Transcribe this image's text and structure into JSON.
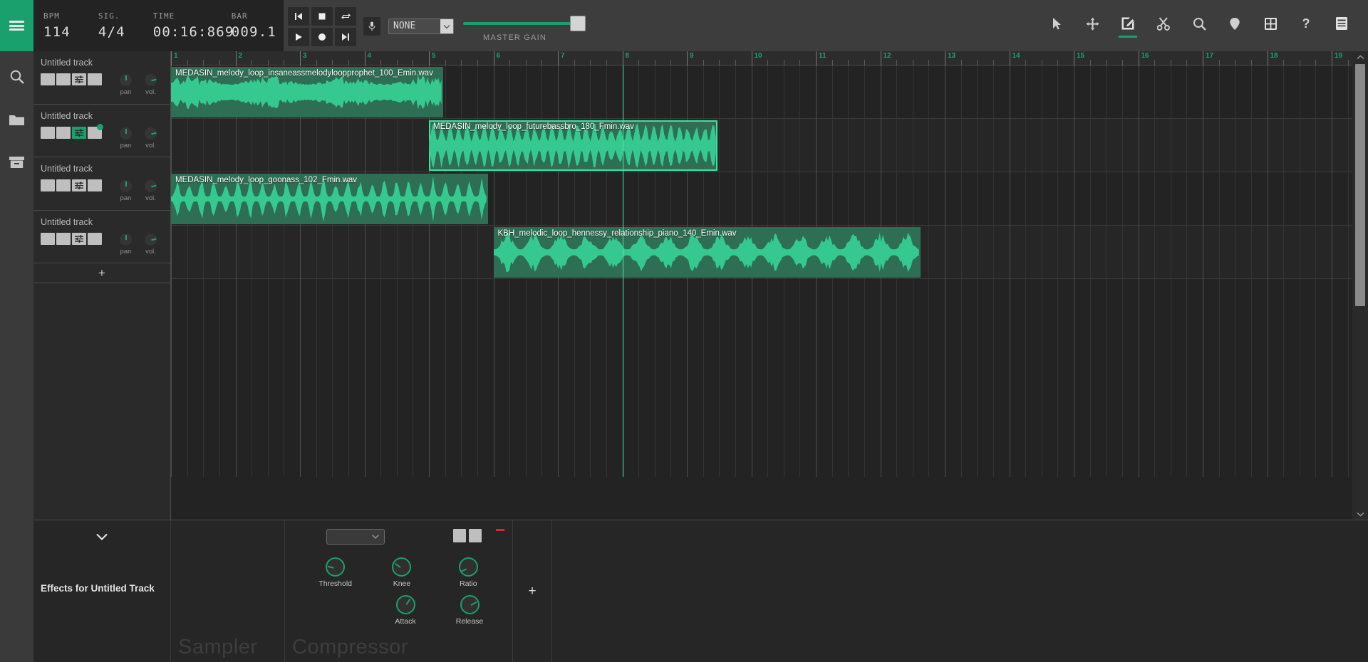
{
  "app": {
    "accent": "#1aa06d",
    "clip_color": "#2e6e55",
    "wave_color": "#35c98f",
    "selected_border": "#3ce0a0"
  },
  "topbar": {
    "menu_icon": "hamburger-icon",
    "lcd": [
      {
        "label": "BPM",
        "value": "114",
        "name": "bpm"
      },
      {
        "label": "SIG.",
        "value": "4/4",
        "name": "time-signature"
      },
      {
        "label": "TIME",
        "value": "00:16:869",
        "name": "time"
      },
      {
        "label": "BAR",
        "value": "009.1",
        "name": "bar"
      }
    ],
    "transport": [
      {
        "name": "skip-to-start-button",
        "icon": "skip-back-icon"
      },
      {
        "name": "stop-button",
        "icon": "stop-icon"
      },
      {
        "name": "loop-button",
        "icon": "loop-icon"
      },
      {
        "name": "play-button",
        "icon": "play-icon"
      },
      {
        "name": "record-button",
        "icon": "record-icon"
      },
      {
        "name": "skip-to-end-button",
        "icon": "skip-forward-icon"
      }
    ],
    "mic_icon": "microphone-icon",
    "input_select": {
      "value": "NONE",
      "options": [
        "NONE"
      ]
    },
    "master_gain": {
      "label": "MASTER GAIN",
      "value": 100
    },
    "tools": [
      {
        "name": "select-tool",
        "icon": "cursor-arrow-icon",
        "active": false
      },
      {
        "name": "move-tool",
        "icon": "move-arrows-icon",
        "active": false
      },
      {
        "name": "draw-tool",
        "icon": "pencil-edit-icon",
        "active": true
      },
      {
        "name": "cut-tool",
        "icon": "scissors-icon",
        "active": false
      },
      {
        "name": "zoom-tool",
        "icon": "magnifier-icon",
        "active": false
      },
      {
        "name": "marker-tool",
        "icon": "map-pin-icon",
        "active": false
      },
      {
        "name": "grid-tool",
        "icon": "grid-icon",
        "active": false
      },
      {
        "name": "help-button",
        "icon": "question-mark-icon",
        "active": false
      },
      {
        "name": "list-panel-button",
        "icon": "list-icon",
        "active": false
      }
    ]
  },
  "rail": [
    {
      "name": "sidebar-item-search",
      "icon": "search-icon"
    },
    {
      "name": "sidebar-item-files",
      "icon": "folder-icon"
    },
    {
      "name": "sidebar-item-library",
      "icon": "archive-box-icon"
    }
  ],
  "tracks": [
    {
      "name": "Untitled track",
      "fx_active": false,
      "has_dot": false,
      "pan": 0,
      "vol": 78
    },
    {
      "name": "Untitled track",
      "fx_active": true,
      "has_dot": true,
      "pan": 0,
      "vol": 78
    },
    {
      "name": "Untitled track",
      "fx_active": false,
      "has_dot": false,
      "pan": 0,
      "vol": 78
    },
    {
      "name": "Untitled track",
      "fx_active": false,
      "has_dot": false,
      "pan": 0,
      "vol": 78
    }
  ],
  "add_track_label": "+",
  "ruler": {
    "bars": [
      1,
      2,
      3,
      4,
      5,
      6,
      7,
      8,
      9,
      10,
      11,
      12,
      13,
      14,
      15,
      16,
      17,
      18,
      19
    ],
    "beats_per_bar": 4
  },
  "playhead": {
    "bar": 8.0
  },
  "clips": [
    {
      "title": "MEDASIN_melody_loop_insaneassmelodyloopprophet_100_Emin.wav",
      "track": 0,
      "start_bar": 1.0,
      "end_bar": 5.22,
      "selected": false
    },
    {
      "title": "MEDASIN_melody_loop_futurebassbro_180_Fmin.wav",
      "track": 1,
      "start_bar": 5.0,
      "end_bar": 9.47,
      "selected": true
    },
    {
      "title": "MEDASIN_melody_loop_goonass_102_Fmin.wav",
      "track": 2,
      "start_bar": 1.0,
      "end_bar": 5.92,
      "selected": false
    },
    {
      "title": "KBH_melodic_loop_hennessy_relationship_piano_140_Emin.wav",
      "track": 3,
      "start_bar": 6.0,
      "end_bar": 12.62,
      "selected": false
    }
  ],
  "effects_panel": {
    "title": "Effects for Untitled Track",
    "collapse_icon": "chevron-down-icon",
    "slots": [
      {
        "name": "Sampler",
        "type": "sampler"
      },
      {
        "name": "Compressor",
        "type": "compressor"
      }
    ],
    "compressor": {
      "preset_select": {
        "value": "",
        "options": []
      },
      "buttons": [
        {
          "name": "bypass-button"
        },
        {
          "name": "power-button"
        }
      ],
      "indicator_color": "#d03030",
      "knobs": [
        {
          "label": "Threshold",
          "value": 22
        },
        {
          "label": "Knee",
          "value": 30
        },
        {
          "label": "Ratio",
          "value": 8
        },
        {
          "label": "Attack",
          "value": 62
        },
        {
          "label": "Release",
          "value": 72
        }
      ]
    },
    "add_effect_label": "+"
  },
  "scrollbar": {
    "up_icon": "chevron-up-icon",
    "down_icon": "chevron-down-icon"
  }
}
